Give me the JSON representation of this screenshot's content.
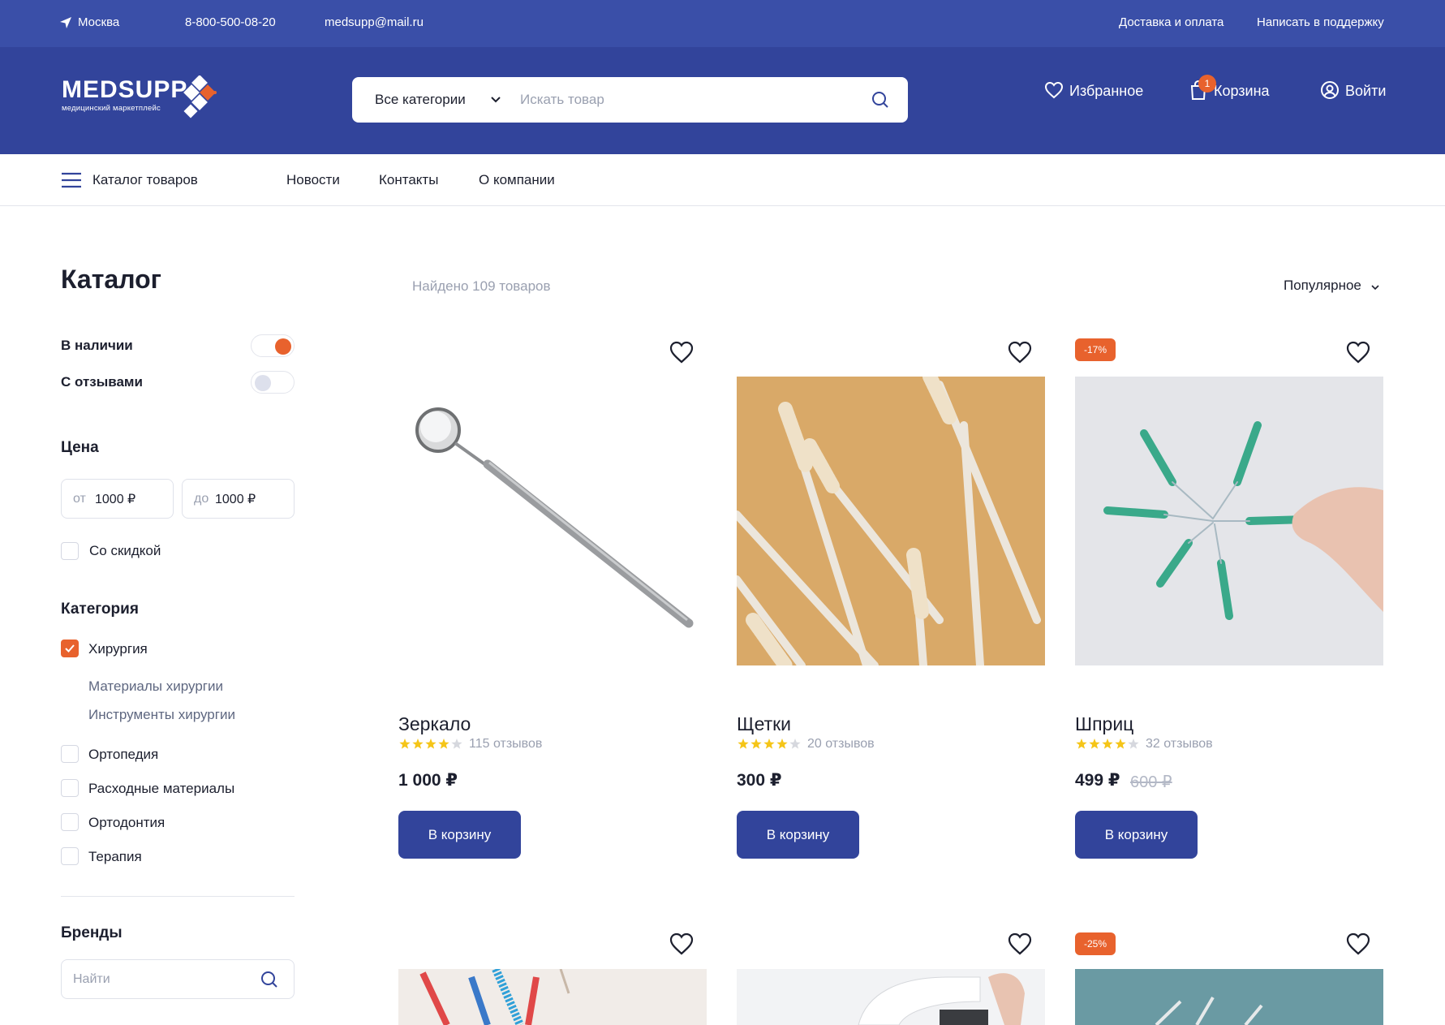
{
  "topbar": {
    "city": "Москва",
    "phone": "8-800-500-08-20",
    "email": "medsupp@mail.ru",
    "delivery": "Доставка и оплата",
    "support": "Написать в поддержку"
  },
  "header": {
    "logo_word": "MEDSUPP",
    "logo_sub": "медицинский маркетплейс",
    "search_category": "Все категории",
    "search_placeholder": "Искать товар",
    "favorites": "Избранное",
    "cart": "Корзина",
    "cart_count": "1",
    "login": "Войти"
  },
  "nav": {
    "catalog": "Каталог товаров",
    "news": "Новости",
    "contacts": "Контакты",
    "about": "О компании"
  },
  "sidebar": {
    "title": "Каталог",
    "in_stock": "В наличии",
    "in_stock_on": true,
    "with_reviews": "С отзывами",
    "with_reviews_on": false,
    "price_title": "Цена",
    "price_from_label": "от",
    "price_from": "1000 ₽",
    "price_to_label": "до",
    "price_to": "1000 ₽",
    "discount": "Со скидкой",
    "category_title": "Категория",
    "categories": [
      {
        "label": "Хирургия",
        "checked": true
      },
      {
        "label": "Ортопедия",
        "checked": false
      },
      {
        "label": "Расходные материалы",
        "checked": false
      },
      {
        "label": "Ортодонтия",
        "checked": false
      },
      {
        "label": "Терапия",
        "checked": false
      }
    ],
    "subcategories": [
      "Материалы хирургии",
      "Инструменты хирургии"
    ],
    "brands_title": "Бренды",
    "brands_placeholder": "Найти"
  },
  "results": {
    "found": "Найдено 109 товаров",
    "sort": "Популярное"
  },
  "products": [
    {
      "name": "Зеркало",
      "rating": 4,
      "reviews": "115 отзывов",
      "price": "1 000 ₽",
      "old_price": "",
      "discount": "",
      "button": "В корзину",
      "icon": "dental-mirror"
    },
    {
      "name": "Щетки",
      "rating": 4,
      "reviews": "20 отзывов",
      "price": "300 ₽",
      "old_price": "",
      "discount": "",
      "button": "В корзину",
      "icon": "brushes"
    },
    {
      "name": "Шприц",
      "rating": 4,
      "reviews": "32 отзывов",
      "price": "499 ₽",
      "old_price": "600 ₽",
      "discount": "-17%",
      "button": "В корзину",
      "icon": "syringes"
    }
  ],
  "products_row2": [
    {
      "discount": ""
    },
    {
      "discount": ""
    },
    {
      "discount": "-25%"
    }
  ],
  "colors": {
    "brand": "#32449b",
    "topbar": "#3a4fa8",
    "accent": "#e8622d",
    "star": "#f5c518"
  }
}
